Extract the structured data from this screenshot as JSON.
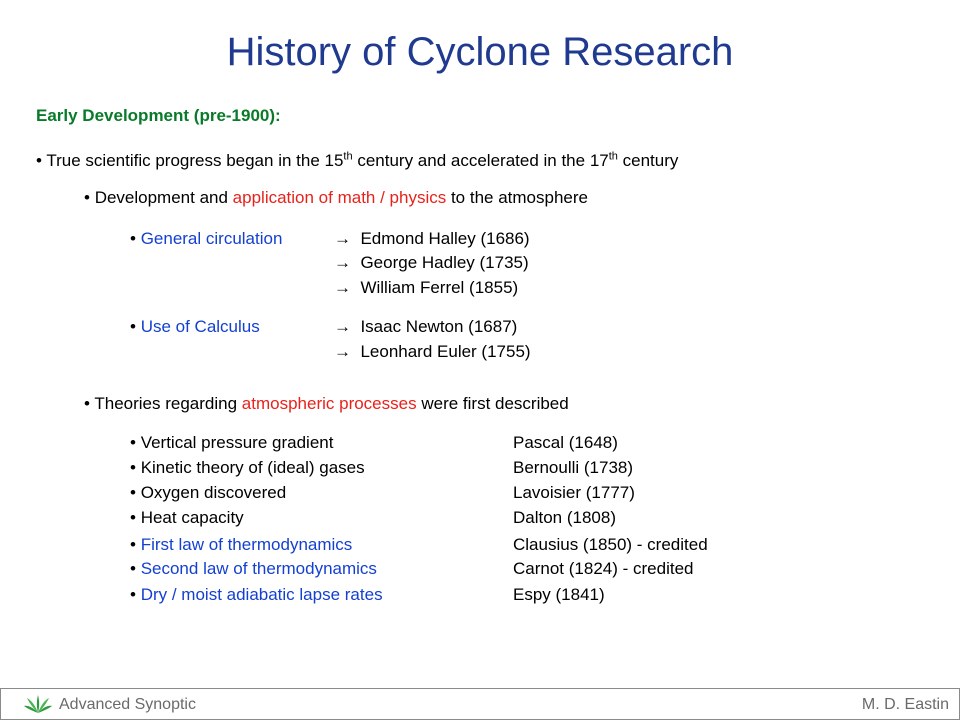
{
  "slide": {
    "title": "History of Cyclone Research",
    "section_heading": "Early Development (pre-1900):",
    "bullet1": {
      "marker": "•",
      "text_a": "True scientific progress began in the 15",
      "sup_a": "th",
      "text_b": " century and accelerated in the 17",
      "sup_b": "th",
      "text_c": " century"
    },
    "bullet2": {
      "marker": "•",
      "text_a": "Development and ",
      "highlight": "application of math / physics",
      "text_b": " to the atmosphere"
    },
    "general_circulation": {
      "marker": "•",
      "label": "General circulation",
      "arrow": "→",
      "entries": [
        "Edmond Halley (1686)",
        "George Hadley (1735)",
        "William Ferrel (1855)"
      ]
    },
    "calculus": {
      "marker": "•",
      "label": "Use of Calculus",
      "arrow": "→",
      "entries": [
        "Isaac Newton (1687)",
        "Leonhard Euler (1755)"
      ]
    },
    "bullet3": {
      "marker": "•",
      "text_a": "Theories regarding ",
      "highlight": "atmospheric processes",
      "text_b": " were first described"
    },
    "theories": [
      {
        "marker": "•",
        "topic": "Vertical pressure gradient",
        "person": "Pascal (1648)",
        "color": "#000000"
      },
      {
        "marker": "•",
        "topic": "Kinetic theory of (ideal) gases",
        "person": "Bernoulli (1738)",
        "color": "#000000"
      },
      {
        "marker": "•",
        "topic": "Oxygen discovered",
        "person": "Lavoisier (1777)",
        "color": "#000000"
      },
      {
        "marker": "•",
        "topic": "Heat capacity",
        "person": "Dalton (1808)",
        "color": "#000000"
      },
      {
        "marker": "•",
        "topic": "First law of thermodynamics",
        "person": "Clausius (1850) - credited",
        "color": "#1440d0"
      },
      {
        "marker": "•",
        "topic": "Second law of thermodynamics",
        "person": "Carnot (1824) - credited",
        "color": "#1440d0"
      },
      {
        "marker": "•",
        "topic": "Dry / moist adiabatic lapse rates",
        "person": "Espy (1841)",
        "color": "#1440d0"
      }
    ]
  },
  "footer": {
    "course": "Advanced Synoptic",
    "author": "M. D. Eastin",
    "logo_icon": "leaf-logo-icon"
  },
  "colors": {
    "title": "#1f3a8f",
    "section": "#0a7a2a",
    "highlight_red": "#e8221b",
    "highlight_blue": "#1440d0",
    "footer_text": "#6a6a6a"
  }
}
